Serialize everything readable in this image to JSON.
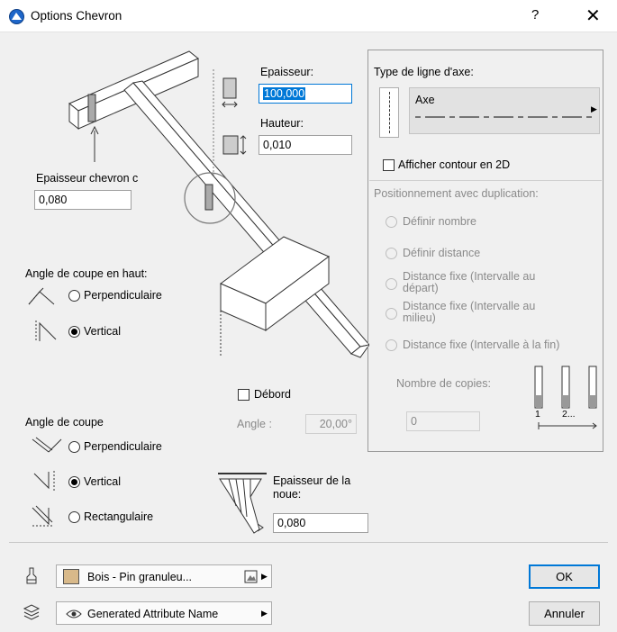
{
  "window": {
    "title": "Options Chevron",
    "help": "?",
    "close": "✕"
  },
  "left": {
    "epaisseur_chevron_label": "Epaisseur chevron c",
    "epaisseur_chevron_value": "0,080",
    "angle_haut_label": "Angle de coupe en haut:",
    "haut_options": [
      "Perpendiculaire",
      "Vertical"
    ],
    "angle_bas_label": "Angle de coupe",
    "bas_options": [
      "Perpendiculaire",
      "Vertical",
      "Rectangulaire"
    ]
  },
  "middle": {
    "epaisseur_label": "Epaisseur:",
    "epaisseur_value": "100,000",
    "hauteur_label": "Hauteur:",
    "hauteur_value": "0,010",
    "debord_label": "Débord",
    "angle_label": "Angle :",
    "angle_value": "20,00°",
    "noue_label_1": "Epaisseur de la",
    "noue_label_2": "noue:",
    "noue_value": "0,080"
  },
  "right": {
    "type_ligne_label": "Type de ligne d'axe:",
    "axe_label": "Axe",
    "afficher_label": "Afficher contour en 2D",
    "positionnement_label": "Positionnement avec duplication:",
    "options": [
      "Définir nombre",
      "Définir distance",
      "Distance fixe (Intervalle au départ)",
      "Distance fixe (Intervalle au milieu)",
      "Distance fixe (Intervalle à la fin)"
    ],
    "nombre_label": "Nombre de copies:",
    "nombre_value": "0",
    "scale_1": "1",
    "scale_2": "2..."
  },
  "bottom": {
    "material": "Bois - Pin granuleu...",
    "layer": "Generated Attribute Name",
    "ok": "OK",
    "cancel": "Annuler",
    "material_color": "#d8b98a"
  }
}
